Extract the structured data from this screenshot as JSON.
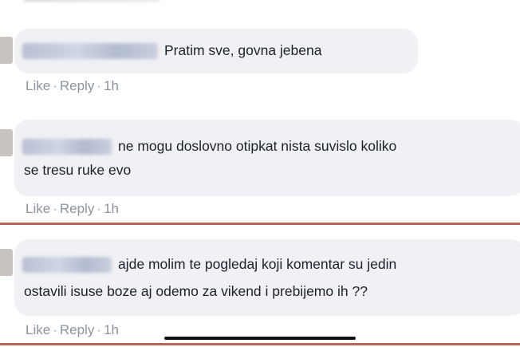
{
  "comments": [
    {
      "text_line1": "Pratim sve, govna jebena",
      "text_line2": "",
      "like_label": "Like",
      "reply_label": "Reply",
      "time": "1h"
    },
    {
      "text_line1": "ne mogu doslovno otipkat nista suvislo koliko",
      "text_line2": "se tresu ruke evo",
      "like_label": "Like",
      "reply_label": "Reply",
      "time": "1h"
    },
    {
      "text_line1": "ajde molim te pogledaj koji komentar su jedin",
      "text_line2": "ostavili isuse boze aj odemo za vikend i prebijemo ih ??",
      "like_label": "Like",
      "reply_label": "Reply",
      "time": "1h"
    }
  ],
  "separator_char": "·",
  "colors": {
    "bubble_bg": "#f0f1f4",
    "meta_text": "#8d949e",
    "annotation_red": "#b4473a"
  }
}
